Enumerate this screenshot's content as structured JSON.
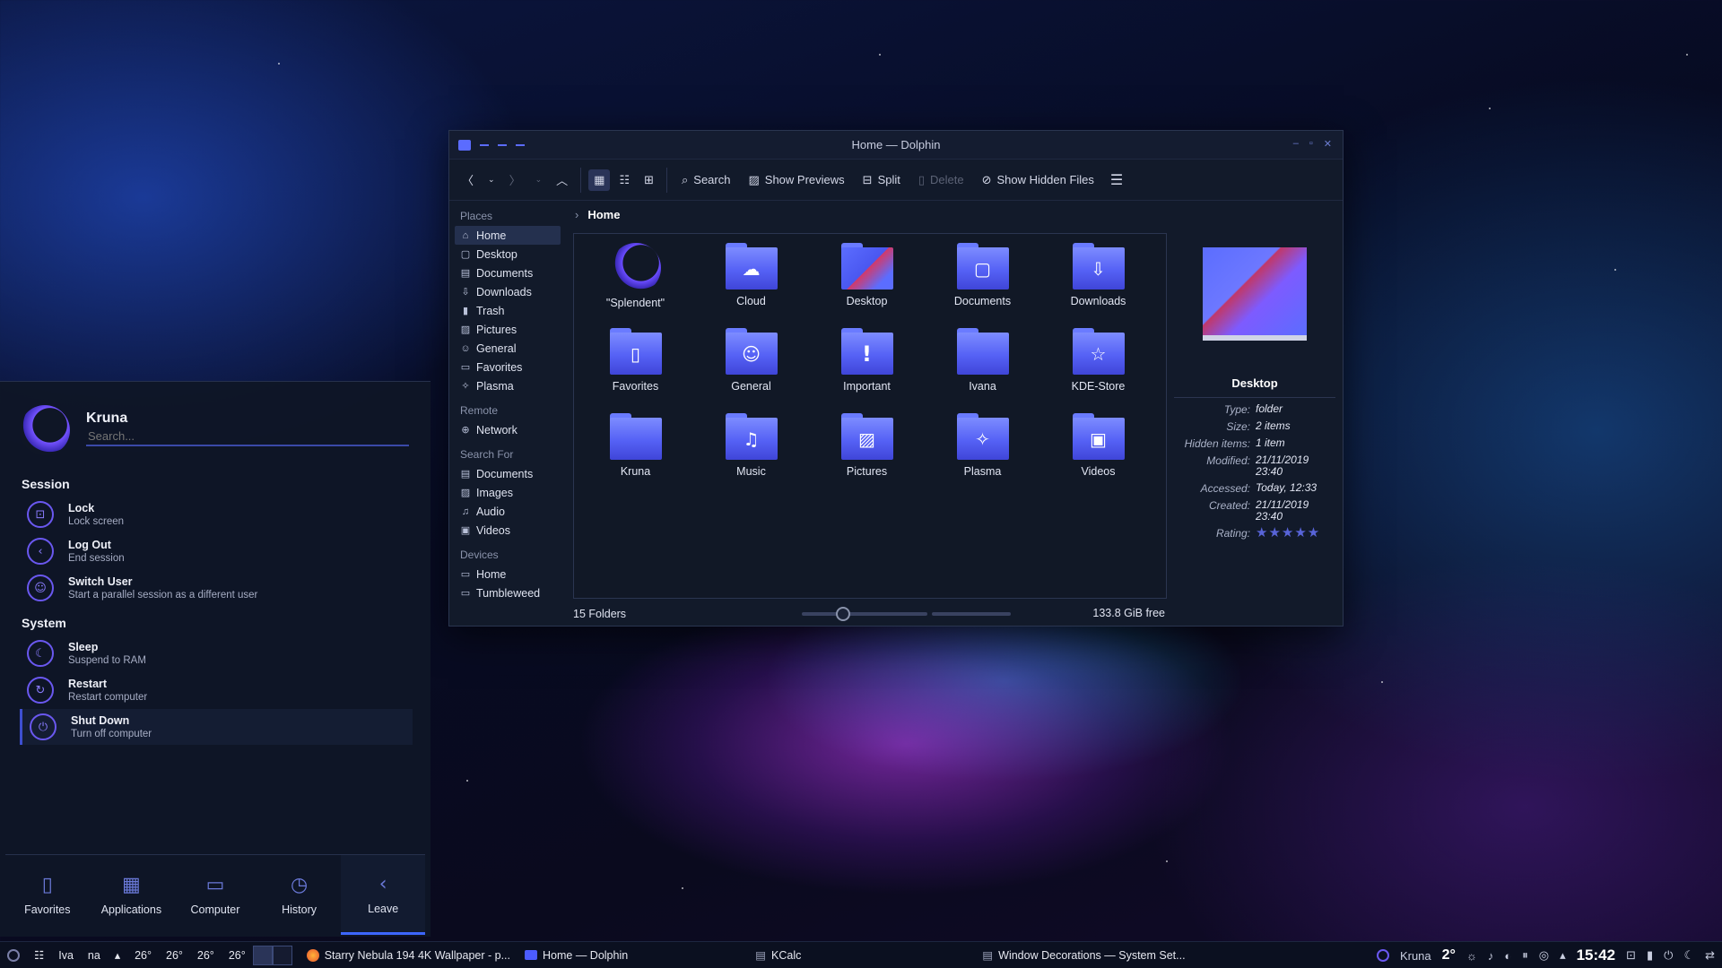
{
  "dolphin": {
    "title": "Home — Dolphin",
    "toolbar": {
      "search": "Search",
      "show_previews": "Show Previews",
      "split": "Split",
      "delete": "Delete",
      "show_hidden": "Show Hidden Files"
    },
    "places_header": "Places",
    "places": [
      "Home",
      "Desktop",
      "Documents",
      "Downloads",
      "Trash",
      "Pictures",
      "General",
      "Favorites",
      "Plasma"
    ],
    "remote_header": "Remote",
    "remote": [
      "Network"
    ],
    "search_header": "Search For",
    "search_for": [
      "Documents",
      "Images",
      "Audio",
      "Videos"
    ],
    "devices_header": "Devices",
    "devices": [
      "Home",
      "Tumbleweed"
    ],
    "breadcrumb": "Home",
    "items": [
      "\"Splendent\"",
      "Cloud",
      "Desktop",
      "Documents",
      "Downloads",
      "Favorites",
      "General",
      "Important",
      "Ivana",
      "KDE-Store",
      "Kruna",
      "Music",
      "Pictures",
      "Plasma",
      "Videos"
    ],
    "status_count": "15 Folders",
    "free_space": "133.8 GiB free",
    "info": {
      "title": "Desktop",
      "type_label": "Type:",
      "type": "folder",
      "size_label": "Size:",
      "size": "2 items",
      "hidden_label": "Hidden items:",
      "hidden": "1 item",
      "modified_label": "Modified:",
      "modified": "21/11/2019 23:40",
      "accessed_label": "Accessed:",
      "accessed": "Today, 12:33",
      "created_label": "Created:",
      "created": "21/11/2019 23:40",
      "rating_label": "Rating:"
    }
  },
  "launcher": {
    "user": "Kruna",
    "search_placeholder": "Search...",
    "session_header": "Session",
    "session": [
      {
        "title": "Lock",
        "sub": "Lock screen"
      },
      {
        "title": "Log Out",
        "sub": "End session"
      },
      {
        "title": "Switch User",
        "sub": "Start a parallel session as a different user"
      }
    ],
    "system_header": "System",
    "system": [
      {
        "title": "Sleep",
        "sub": "Suspend to RAM"
      },
      {
        "title": "Restart",
        "sub": "Restart computer"
      },
      {
        "title": "Shut Down",
        "sub": "Turn off computer"
      }
    ],
    "tabs": [
      "Favorites",
      "Applications",
      "Computer",
      "History",
      "Leave"
    ]
  },
  "taskbar": {
    "label_iva": "Iva",
    "label_na": "na",
    "temps": [
      "26°",
      "26°",
      "26°",
      "26°"
    ],
    "tasks": [
      "Starry Nebula 194 4K Wallpaper - p...",
      "Home — Dolphin",
      "KCalc",
      "Window Decorations — System Set..."
    ],
    "user": "Kruna",
    "weather": "2°",
    "clock": "15:42"
  },
  "colors": {
    "accent": "#5b6cff",
    "panel": "#121a2a"
  }
}
